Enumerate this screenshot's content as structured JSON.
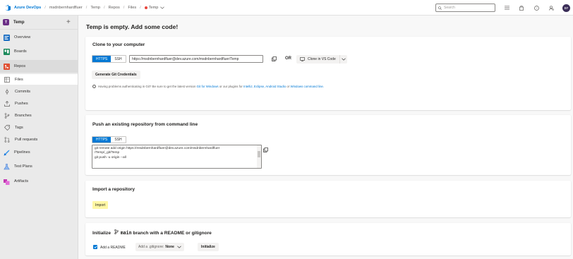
{
  "header": {
    "brand": "Azure DevOps",
    "breadcrumbs": [
      "msdnbernhardfluer",
      "Temp",
      "Repos",
      "Files",
      "Temp"
    ],
    "search_placeholder": "Search",
    "avatar_initials": "BF",
    "icons": [
      "list-icon",
      "shopping-bag-icon",
      "help-icon",
      "user-settings-icon"
    ]
  },
  "sidebar": {
    "project_badge": "T",
    "project_name": "Temp",
    "add_label": "+",
    "items": [
      {
        "label": "Overview",
        "icon": "overview-icon"
      },
      {
        "label": "Boards",
        "icon": "boards-icon"
      },
      {
        "label": "Repos",
        "icon": "repos-icon"
      },
      {
        "label": "Files",
        "icon": "files-icon"
      },
      {
        "label": "Commits",
        "icon": "commits-icon"
      },
      {
        "label": "Pushes",
        "icon": "pushes-icon"
      },
      {
        "label": "Branches",
        "icon": "branches-icon"
      },
      {
        "label": "Tags",
        "icon": "tags-icon"
      },
      {
        "label": "Pull requests",
        "icon": "pull-requests-icon"
      },
      {
        "label": "Pipelines",
        "icon": "pipelines-icon"
      },
      {
        "label": "Test Plans",
        "icon": "test-plans-icon"
      },
      {
        "label": "Artifacts",
        "icon": "artifacts-icon"
      }
    ]
  },
  "main": {
    "title": "Temp is empty. Add some code!",
    "clone": {
      "heading": "Clone to your computer",
      "https": "HTTPS",
      "ssh": "SSH",
      "url": "https://msdnbernhardfluer@dev.azure.com/msdnbernhardfluer/Temp",
      "or": "OR",
      "vscode": "Clone in VS Code",
      "credentials": "Generate Git Credentials",
      "hint_prefix": "Having problems authenticating in Git? Be sure to get the latest version",
      "hint_link1": "Git for Windows",
      "hint_mid": "or our plugins for",
      "hint_link2": "IntelliJ, Eclipse, Android Studio",
      "hint_or": "or",
      "hint_link3": "Windows command line."
    },
    "push": {
      "heading": "Push an existing repository from command line",
      "https": "HTTPS",
      "ssh": "SSH",
      "lines": [
        "git remote add origin https://msdnbernhardfluer@dev.azure.com/msdnbernhardfluer",
        "/Temp/_git/Temp",
        "git push -u origin --all"
      ]
    },
    "import": {
      "heading": "Import a repository",
      "button": "Import"
    },
    "init": {
      "heading_pre": "Initialize",
      "branch": "main",
      "heading_post": "branch with a README or gitignore",
      "readme": "Add a README",
      "gitignore_label": "Add a .gitignore:",
      "gitignore_value": "None",
      "initialize": "Initialize"
    }
  },
  "colors": {
    "accent": "#0078d4",
    "highlight": "#fff7a5"
  }
}
